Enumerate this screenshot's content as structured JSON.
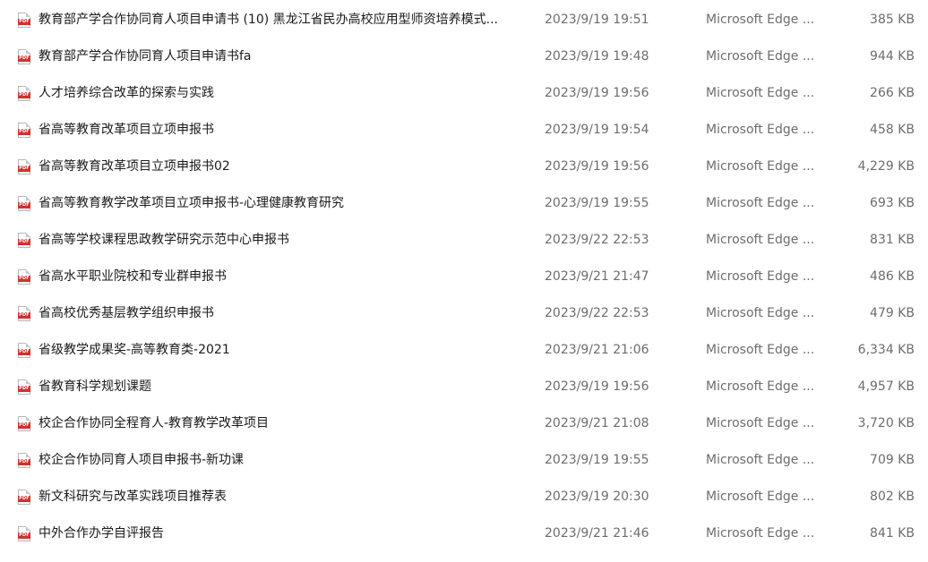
{
  "files": [
    {
      "icon": "pdf-icon",
      "icon_label": "PDF",
      "name": "教育部产学合作协同育人项目申请书 (10) 黑龙江省民办高校应用型师资培养模式...",
      "date": "2023/9/19 19:51",
      "type": "Microsoft Edge ...",
      "size": "385 KB"
    },
    {
      "icon": "pdf-icon",
      "icon_label": "PDF",
      "name": "教育部产学合作协同育人项目申请书fa",
      "date": "2023/9/19 19:48",
      "type": "Microsoft Edge ...",
      "size": "944 KB"
    },
    {
      "icon": "pdf-icon",
      "icon_label": "PDF",
      "name": "人才培养综合改革的探索与实践",
      "date": "2023/9/19 19:56",
      "type": "Microsoft Edge ...",
      "size": "266 KB"
    },
    {
      "icon": "pdf-icon",
      "icon_label": "PDF",
      "name": "省高等教育改革项目立项申报书",
      "date": "2023/9/19 19:54",
      "type": "Microsoft Edge ...",
      "size": "458 KB"
    },
    {
      "icon": "pdf-icon",
      "icon_label": "PDF",
      "name": "省高等教育改革项目立项申报书02",
      "date": "2023/9/19 19:56",
      "type": "Microsoft Edge ...",
      "size": "4,229 KB"
    },
    {
      "icon": "pdf-icon",
      "icon_label": "PDF",
      "name": "省高等教育教学改革项目立项申报书-心理健康教育研究",
      "date": "2023/9/19 19:55",
      "type": "Microsoft Edge ...",
      "size": "693 KB"
    },
    {
      "icon": "pdf-icon",
      "icon_label": "PDF",
      "name": "省高等学校课程思政教学研究示范中心申报书",
      "date": "2023/9/22 22:53",
      "type": "Microsoft Edge ...",
      "size": "831 KB"
    },
    {
      "icon": "pdf-icon",
      "icon_label": "PDF",
      "name": "省高水平职业院校和专业群申报书",
      "date": "2023/9/21 21:47",
      "type": "Microsoft Edge ...",
      "size": "486 KB"
    },
    {
      "icon": "pdf-icon",
      "icon_label": "PDF",
      "name": "省高校优秀基层教学组织申报书",
      "date": "2023/9/22 22:53",
      "type": "Microsoft Edge ...",
      "size": "479 KB"
    },
    {
      "icon": "pdf-icon",
      "icon_label": "PDF",
      "name": "省级教学成果奖-高等教育类-2021",
      "date": "2023/9/21 21:06",
      "type": "Microsoft Edge ...",
      "size": "6,334 KB"
    },
    {
      "icon": "pdf-icon",
      "icon_label": "PDF",
      "name": "省教育科学规划课题",
      "date": "2023/9/19 19:56",
      "type": "Microsoft Edge ...",
      "size": "4,957 KB"
    },
    {
      "icon": "pdf-icon",
      "icon_label": "PDF",
      "name": "校企合作协同全程育人-教育教学改革项目",
      "date": "2023/9/21 21:08",
      "type": "Microsoft Edge ...",
      "size": "3,720 KB"
    },
    {
      "icon": "pdf-icon",
      "icon_label": "PDF",
      "name": "校企合作协同育人项目申报书-新功课",
      "date": "2023/9/19 19:55",
      "type": "Microsoft Edge ...",
      "size": "709 KB"
    },
    {
      "icon": "pdf-icon",
      "icon_label": "PDF",
      "name": "新文科研究与改革实践项目推荐表",
      "date": "2023/9/19 20:30",
      "type": "Microsoft Edge ...",
      "size": "802 KB"
    },
    {
      "icon": "pdf-icon",
      "icon_label": "PDF",
      "name": "中外合作办学自评报告",
      "date": "2023/9/21 21:46",
      "type": "Microsoft Edge ...",
      "size": "841 KB"
    }
  ],
  "colors": {
    "pdf_icon_red": "#d0312d",
    "name_text": "#1a1a1a",
    "meta_text": "#6d6d6d",
    "background": "#ffffff"
  }
}
